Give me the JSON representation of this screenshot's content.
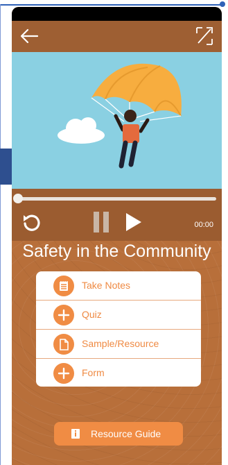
{
  "player": {
    "current_time": "00:00",
    "progress": 0
  },
  "lesson": {
    "title": "Safety in the Community"
  },
  "menu": {
    "items": [
      {
        "label": "Take Notes",
        "icon": "notepad-icon"
      },
      {
        "label": "Quiz",
        "icon": "plus-icon"
      },
      {
        "label": "Sample/Resource",
        "icon": "document-icon"
      },
      {
        "label": "Form",
        "icon": "plus-icon"
      }
    ]
  },
  "footer": {
    "resource_guide_label": "Resource Guide"
  },
  "colors": {
    "accent": "#f08c44",
    "header": "#9e5f33",
    "background": "#b86f3a",
    "video_sky": "#8ad0e2"
  }
}
